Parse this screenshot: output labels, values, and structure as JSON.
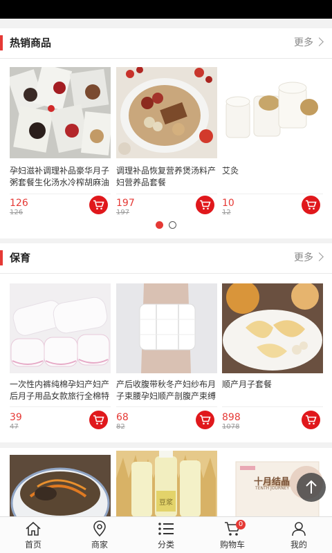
{
  "hot": {
    "title": "热销商品",
    "more": "更多",
    "items": [
      {
        "name": "孕妇滋补调理补品豪华月子粥套餐生化汤水冷榨胡麻油食品",
        "price": "126",
        "original_price": "126"
      },
      {
        "name": "调理补品恢复营养煲汤料产妇营养品套餐",
        "price": "197",
        "original_price": "197"
      },
      {
        "name": "艾灸",
        "price": "10",
        "original_price": "12"
      }
    ],
    "pager": {
      "pages": 2,
      "active": 1
    }
  },
  "care": {
    "title": "保育",
    "more": "更多",
    "items": [
      {
        "name": "一次性内裤纯棉孕妇产妇产后月子用品女款旅行全棉特大码",
        "price": "39",
        "original_price": "47"
      },
      {
        "name": "产后收腹带秋冬产妇纱布月子束腰孕妇顺产剖腹产束缚带",
        "price": "68",
        "original_price": "82"
      },
      {
        "name": "顺产月子套餐",
        "price": "898",
        "original_price": "1078"
      }
    ]
  },
  "third": {
    "package_brand": "十月结晶",
    "package_brand_sub": "TENTH JOURNEY",
    "bottle_label": "豆浆"
  },
  "tabbar": {
    "items": [
      {
        "label": "首页",
        "icon": "home-icon"
      },
      {
        "label": "商家",
        "icon": "location-pin-icon"
      },
      {
        "label": "分类",
        "icon": "list-icon"
      },
      {
        "label": "购物车",
        "icon": "cart-icon",
        "badge": "0"
      },
      {
        "label": "我的",
        "icon": "user-icon"
      }
    ]
  },
  "colors": {
    "accent": "#e53935",
    "background": "#f2f2f2"
  }
}
